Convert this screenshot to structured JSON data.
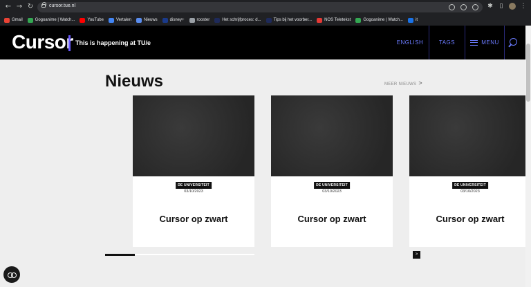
{
  "browser": {
    "url": "cursor.tue.nl",
    "bookmarks": [
      {
        "label": "Gmail",
        "color": "#ea4335"
      },
      {
        "label": "Gogoanime | Watch...",
        "color": "#34a853"
      },
      {
        "label": "YouTube",
        "color": "#ff0000"
      },
      {
        "label": "Vertalen",
        "color": "#4285f4"
      },
      {
        "label": "Nieuws",
        "color": "#5a8dee"
      },
      {
        "label": "disney+",
        "color": "#1a3a8a"
      },
      {
        "label": "rooster",
        "color": "#9aa0a6"
      },
      {
        "label": "Het schrijfproces: d...",
        "color": "#1e2a5a"
      },
      {
        "label": "Tips bij het voorber...",
        "color": "#1e2a5a"
      },
      {
        "label": "NOS Teletekst",
        "color": "#e53935"
      },
      {
        "label": "Gogoanime | Watch...",
        "color": "#34a853"
      },
      {
        "label": "it",
        "color": "#1a73e8"
      }
    ]
  },
  "site": {
    "logo": "Cursor",
    "tagline": "This is happening at TU/e",
    "nav": {
      "english": "ENGLISH",
      "tags": "TAGS",
      "menu": "MENU"
    },
    "accent": "#6b7bff"
  },
  "news": {
    "title": "Nieuws",
    "more": "MEER NIEUWS",
    "more_chevron": ">",
    "cards": [
      {
        "category": "DE UNIVERSITEIT",
        "date": "03/10/2023",
        "title": "Cursor op zwart"
      },
      {
        "category": "DE UNIVERSITEIT",
        "date": "03/10/2023",
        "title": "Cursor op zwart"
      },
      {
        "category": "DE UNIVERSITEIT",
        "date": "03/10/2023",
        "title": "Cursor op zwart"
      }
    ],
    "carousel_progress": 0.2,
    "next_label": ">"
  }
}
